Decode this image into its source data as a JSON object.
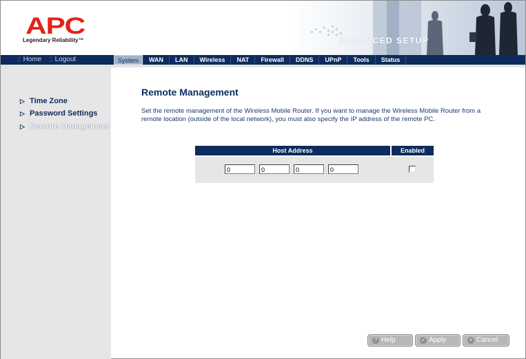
{
  "header": {
    "brand": "APC",
    "tagline": "Legendary Reliability",
    "banner_title": "ADVANCED SETUP"
  },
  "nav": {
    "home_label": "Home",
    "logout_label": "Logout",
    "tabs": [
      "System",
      "WAN",
      "LAN",
      "Wireless",
      "NAT",
      "Firewall",
      "DDNS",
      "UPnP",
      "Tools",
      "Status"
    ],
    "active_tab": "System"
  },
  "sidebar": {
    "items": [
      {
        "label": "Time Zone"
      },
      {
        "label": "Password Settings"
      },
      {
        "label": "Remote Management"
      }
    ]
  },
  "main": {
    "title": "Remote Management",
    "description": "Set the remote management of the Wireless Mobile Router. If you want to manage the Wireless Mobile Router from a remote location (outside of the local network), you must also specify the IP address of the remote PC.",
    "table": {
      "col_host": "Host Address",
      "col_enabled": "Enabled",
      "ip": [
        "0",
        "0",
        "0",
        "0"
      ],
      "enabled": false
    }
  },
  "buttons": {
    "help": "Help",
    "apply": "Apply",
    "cancel": "Cancel"
  },
  "colors": {
    "navy": "#0d2b5c",
    "brand_red": "#e2231a",
    "panel_gray": "#e6e6e6"
  }
}
